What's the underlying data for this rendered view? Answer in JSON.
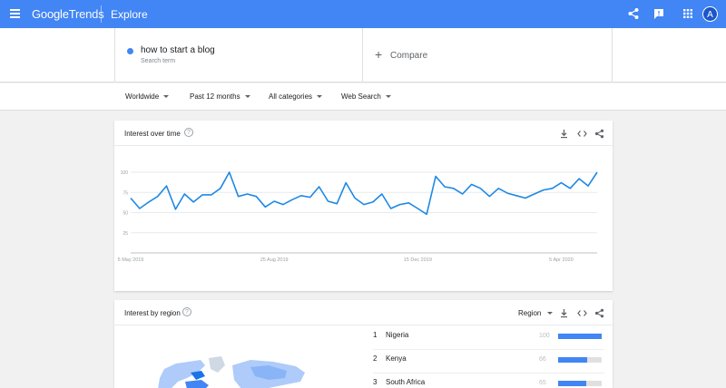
{
  "header": {
    "logo_google": "Google",
    "logo_trends": "Trends",
    "section": "Explore",
    "avatar_letter": "A",
    "icons": [
      "menu-icon",
      "share-icon",
      "feedback-icon",
      "apps-icon"
    ]
  },
  "search": {
    "term": "how to start a blog",
    "term_type": "Search term",
    "term_color": "#4285f4",
    "compare_plus": "+",
    "compare_label": "Compare"
  },
  "filters": {
    "location": "Worldwide",
    "time": "Past 12 months",
    "category": "All categories",
    "property": "Web Search"
  },
  "interest_over_time": {
    "title": "Interest over time",
    "help": "?"
  },
  "interest_by_region": {
    "title": "Interest by region",
    "help": "?",
    "resolution": "Region",
    "rows": [
      {
        "rank": "1",
        "name": "Nigeria",
        "value": "100",
        "fill": 1.0
      },
      {
        "rank": "2",
        "name": "Kenya",
        "value": "66",
        "fill": 0.66
      },
      {
        "rank": "3",
        "name": "South Africa",
        "value": "65",
        "fill": 0.65
      }
    ]
  },
  "chart_data": {
    "type": "line",
    "title": "",
    "xlabel": "",
    "ylabel": "",
    "ylim": [
      0,
      100
    ],
    "yticks": [
      25,
      50,
      75,
      100
    ],
    "ytick_labels": [
      "25",
      "50",
      "75",
      "100"
    ],
    "xtick_labels": [
      "5 May 2019",
      "25 Aug 2019",
      "15 Dec 2019",
      "5 Apr 2020"
    ],
    "xtick_index": [
      0,
      16,
      32,
      48
    ],
    "grid": true,
    "series": [
      {
        "color": "#1e88e5",
        "values": [
          68,
          55,
          63,
          70,
          83,
          54,
          73,
          63,
          72,
          72,
          80,
          100,
          70,
          73,
          70,
          57,
          64,
          60,
          66,
          71,
          69,
          82,
          64,
          61,
          87,
          68,
          60,
          63,
          73,
          55,
          60,
          62,
          55,
          48,
          95,
          82,
          80,
          73,
          85,
          80,
          70,
          80,
          74,
          71,
          68,
          73,
          78,
          80,
          87,
          80,
          92,
          83,
          100
        ]
      }
    ]
  }
}
